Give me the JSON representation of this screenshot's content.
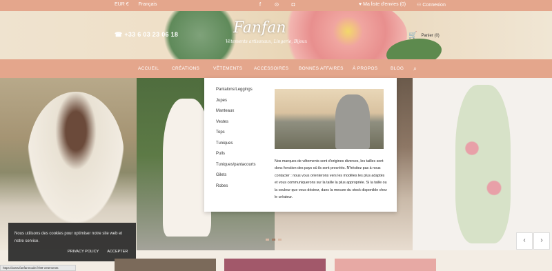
{
  "topbar": {
    "currency": "EUR €",
    "language": "Français",
    "wishlist": "Ma liste d'envies (0)",
    "login": "Connexion"
  },
  "header": {
    "phone": "+33 6 03 23 06 18",
    "logo": "Fanfan",
    "tagline": "Vêtements artisanaux, Lingerie, Bijoux",
    "cart": "Panier (0)"
  },
  "nav": {
    "items": [
      "ACCUEIL",
      "CRÉATIONS",
      "VÊTEMENTS",
      "ACCESSOIRES",
      "BONNES AFFAIRES",
      "À PROPOS",
      "BLOG"
    ]
  },
  "dropdown": {
    "items": [
      "Pantalons/Leggings",
      "Jupes",
      "Manteaux",
      "Vestes",
      "Tops",
      "Tuniques",
      "Pulls",
      "Tuniques/pantacourts",
      "Gilets",
      "Robes"
    ],
    "description": "Nos marques de vêtements sont d'origines diverses, les tailles sont donc fonction des pays où ils sont procréés. N'hésitez pas à nous contacter : nous vous orienterons vers les modèles les plus adaptés et vous communiquerons sur la taille la plus appropriée. Si la taille ou la couleur que vous désirez, dans la mesure du stock disponible chez le créateur."
  },
  "cookie": {
    "message": "Nous utilisons des cookies pour optimiser notre site web et notre service.",
    "privacy": "PRIVACY POLICY",
    "accept": "ACCEPTER"
  },
  "status_url": "https://www.fanfanmode.fr/69-vetements",
  "colors": {
    "accent": "#e4a68c",
    "nav_text": "#ffffff"
  }
}
